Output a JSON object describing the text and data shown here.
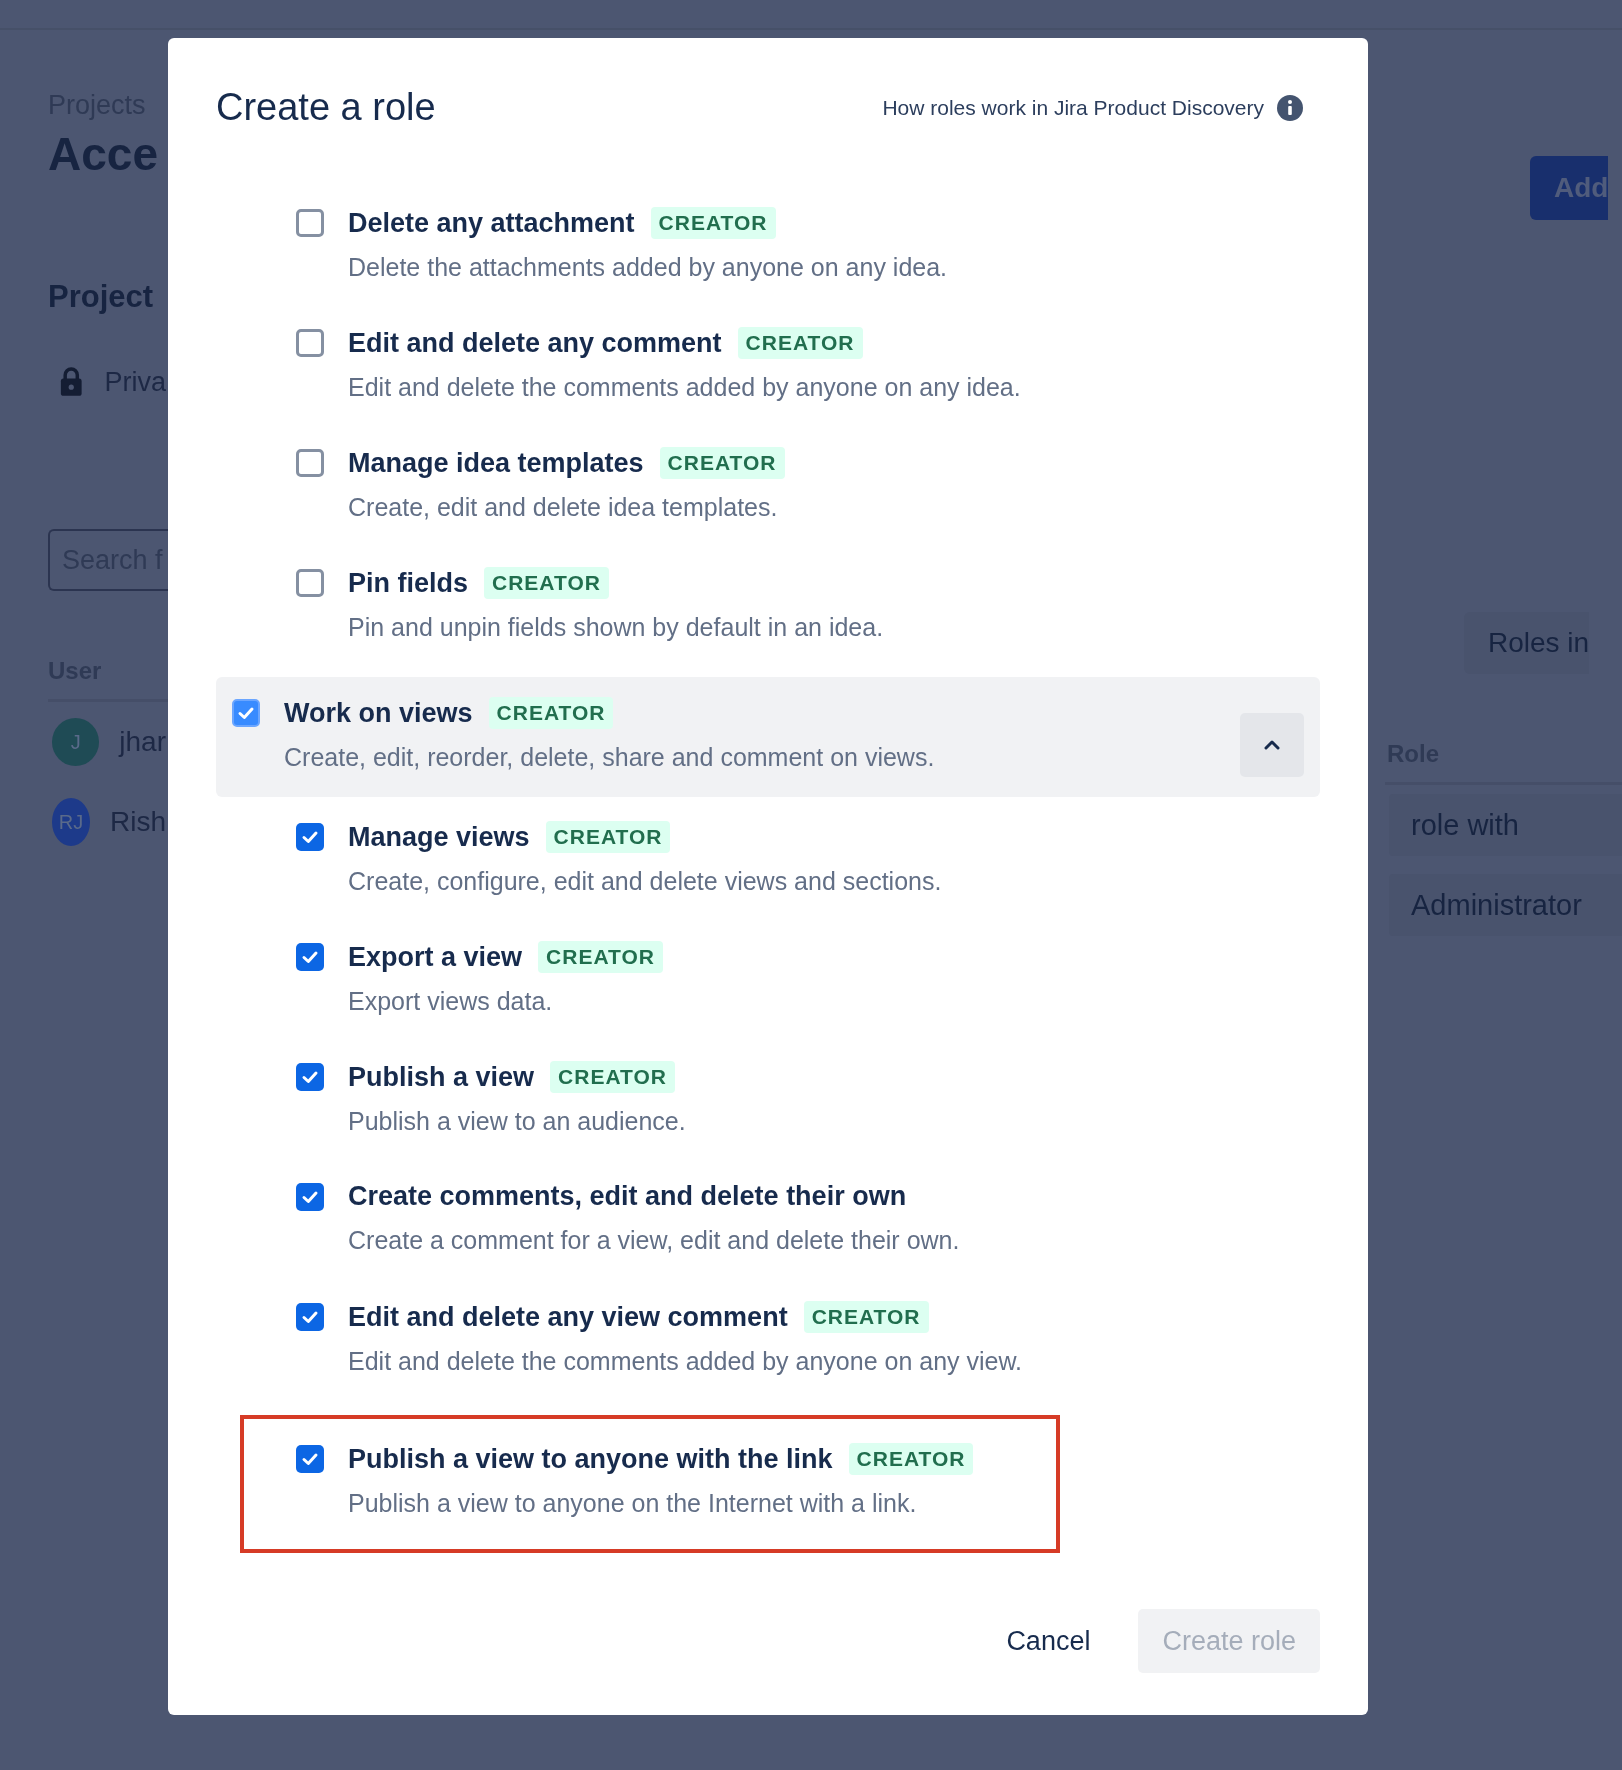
{
  "background_page": {
    "breadcrumb": "Projects",
    "heading": "Acce",
    "section_heading": "Project",
    "access_label": "Priva",
    "search": {
      "placeholder": "Search f"
    },
    "add_button": "Add",
    "roles_button": "Roles in",
    "table": {
      "columns": [
        "User",
        "Role"
      ],
      "rows": [
        {
          "avatar": "J",
          "user": "jhar",
          "role": "role with"
        },
        {
          "avatar": "RJ",
          "user": "Rish",
          "role": "Administrator"
        }
      ]
    }
  },
  "dialog": {
    "title": "Create a role",
    "help_link": "How roles work in Jira Product Discovery",
    "groups": [
      {
        "items": [
          {
            "title": "Delete any attachment",
            "badge": "CREATOR",
            "description": "Delete the attachments added by anyone on any idea.",
            "checked": false,
            "highlighted": false
          },
          {
            "title": "Edit and delete any comment",
            "badge": "CREATOR",
            "description": "Edit and delete the comments added by anyone on any idea.",
            "checked": false,
            "highlighted": false
          },
          {
            "title": "Manage idea templates",
            "badge": "CREATOR",
            "description": "Create, edit and delete idea templates.",
            "checked": false,
            "highlighted": false
          },
          {
            "title": "Pin fields",
            "badge": "CREATOR",
            "description": "Pin and unpin fields shown by default in an idea.",
            "checked": false,
            "highlighted": false
          }
        ]
      },
      {
        "title": "Work on views",
        "badge": "CREATOR",
        "description": "Create, edit, reorder, delete, share and comment on views.",
        "checked": true,
        "expanded": true,
        "items": [
          {
            "title": "Manage views",
            "badge": "CREATOR",
            "description": "Create, configure, edit and delete views and sections.",
            "checked": true,
            "highlighted": false
          },
          {
            "title": "Export a view",
            "badge": "CREATOR",
            "description": "Export views data.",
            "checked": true,
            "highlighted": false
          },
          {
            "title": "Publish a view",
            "badge": "CREATOR",
            "description": "Publish a view to an audience.",
            "checked": true,
            "highlighted": false
          },
          {
            "title": "Create comments, edit and delete their own",
            "description": "Create a comment for a view, edit and delete their own.",
            "checked": true,
            "highlighted": false
          },
          {
            "title": "Edit and delete any view comment",
            "badge": "CREATOR",
            "description": "Edit and delete the comments added by anyone on any view.",
            "checked": true,
            "highlighted": false
          },
          {
            "title": "Publish a view to anyone with the link",
            "badge": "CREATOR",
            "description": "Publish a view to anyone on the Internet with a link.",
            "checked": true,
            "highlighted": true
          }
        ]
      }
    ],
    "buttons": [
      {
        "label": "Cancel",
        "kind": "subtle",
        "disabled": false
      },
      {
        "label": "Create role",
        "kind": "primary",
        "disabled": true
      }
    ]
  }
}
